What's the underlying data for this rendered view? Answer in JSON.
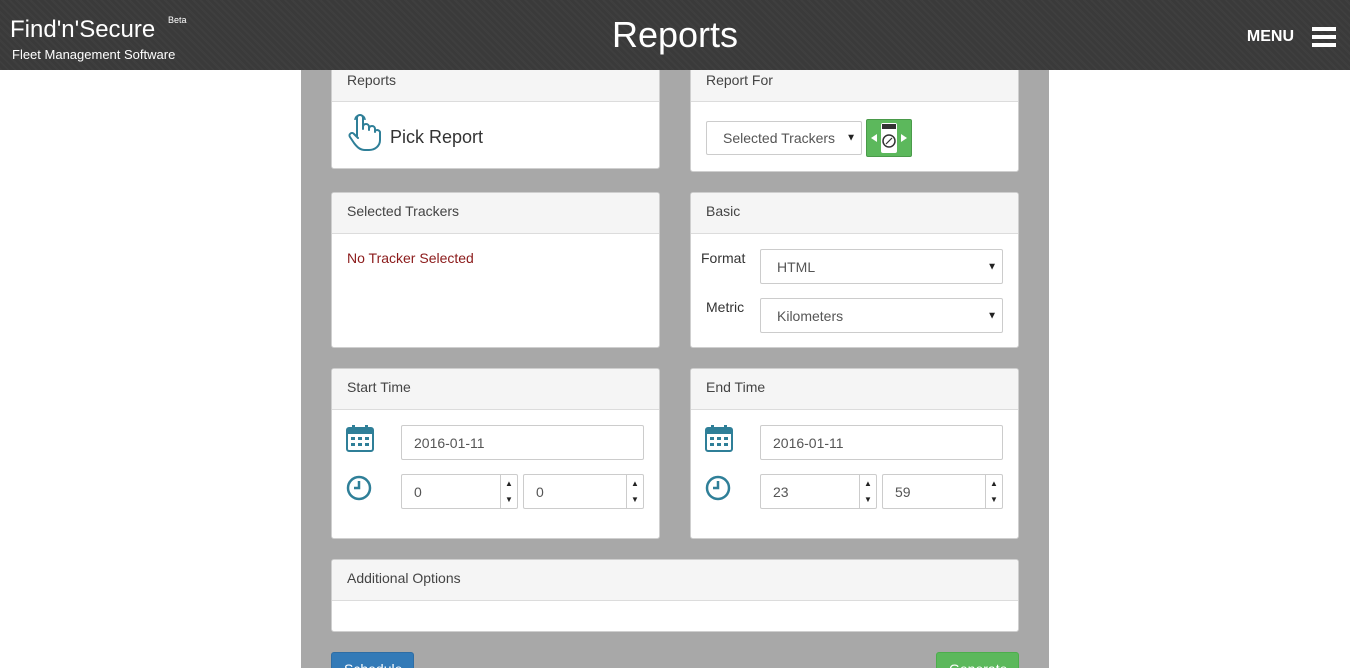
{
  "header": {
    "logo_text": "Find'n'Secure",
    "logo_beta": "Beta",
    "logo_subtitle": "Fleet Management Software",
    "title": "Reports",
    "menu_label": "MENU"
  },
  "reports_panel": {
    "title": "Reports",
    "pick_label": "Pick Report",
    "icon": "pointing-hand-icon"
  },
  "report_for_panel": {
    "title": "Report For",
    "selected_value": "Selected Trackers",
    "tracker_button_icon": "tracker-device-icon"
  },
  "selected_trackers_panel": {
    "title": "Selected Trackers",
    "empty_message": "No Tracker Selected"
  },
  "basic_panel": {
    "title": "Basic",
    "format_label": "Format",
    "format_value": "HTML",
    "metric_label": "Metric",
    "metric_value": "Kilometers"
  },
  "start_time_panel": {
    "title": "Start Time",
    "date": "2016-01-11",
    "hour": "0",
    "minute": "0"
  },
  "end_time_panel": {
    "title": "End Time",
    "date": "2016-01-11",
    "hour": "23",
    "minute": "59"
  },
  "additional_panel": {
    "title": "Additional Options"
  },
  "actions": {
    "schedule_label": "Schedule",
    "generate_label": "Generate"
  },
  "colors": {
    "header_bg": "#3a3a3a",
    "main_bg": "#a8a8a8",
    "accent_teal": "#2f7f98",
    "primary_blue": "#337ab7",
    "success_green": "#5cb85c",
    "error_red": "#8b1a1a"
  }
}
